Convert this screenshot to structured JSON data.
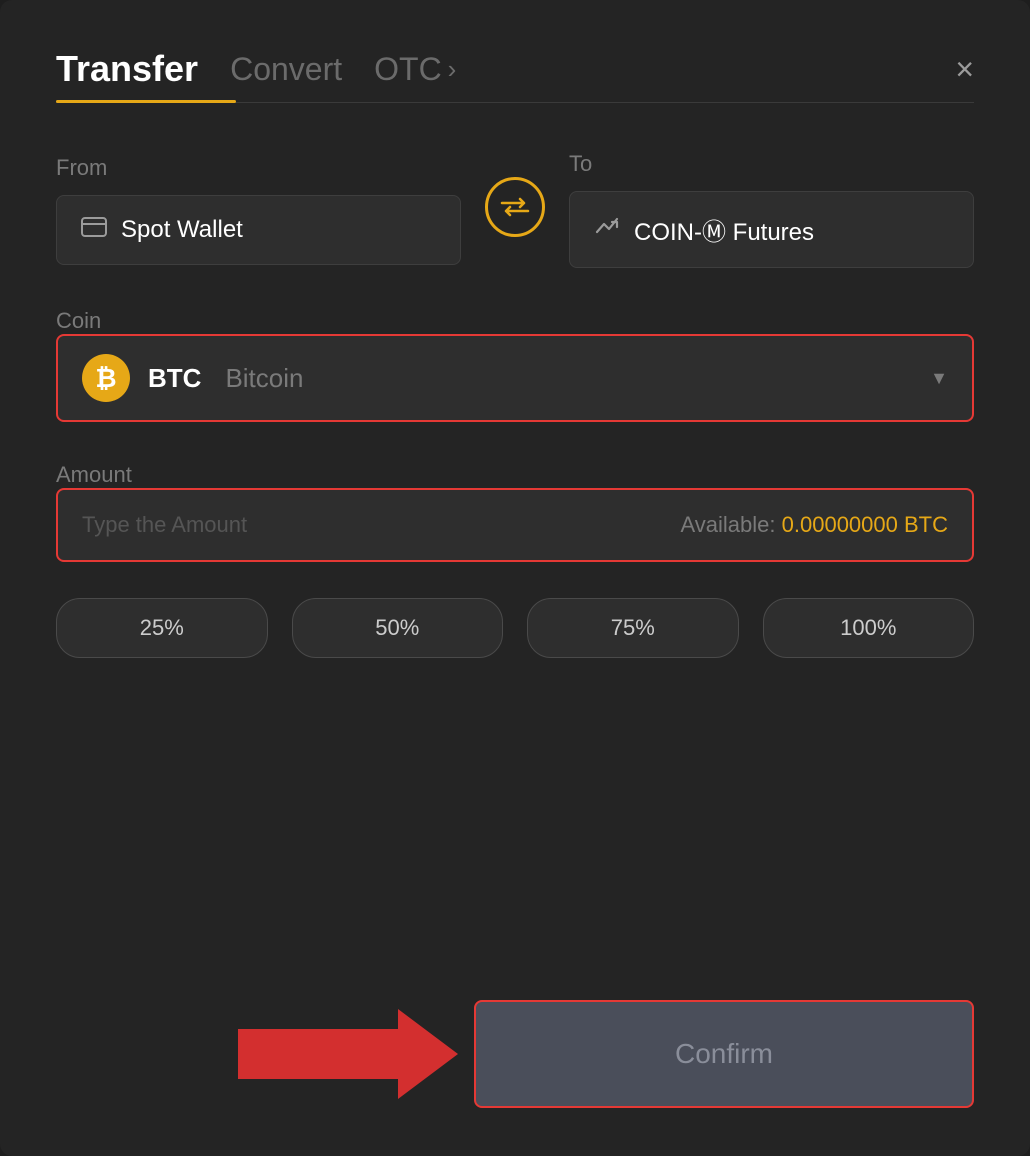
{
  "header": {
    "tab_transfer": "Transfer",
    "tab_convert": "Convert",
    "tab_otc": "OTC",
    "close_label": "×"
  },
  "from": {
    "label": "From",
    "wallet_name": "Spot Wallet"
  },
  "to": {
    "label": "To",
    "wallet_name": "COIN-Ⓜ Futures"
  },
  "coin": {
    "label": "Coin",
    "symbol": "BTC",
    "name": "Bitcoin"
  },
  "amount": {
    "label": "Amount",
    "placeholder": "Type the Amount",
    "available_label": "Available:",
    "available_value": "0.00000000",
    "available_unit": "BTC"
  },
  "percent_buttons": [
    {
      "label": "25%"
    },
    {
      "label": "50%"
    },
    {
      "label": "75%"
    },
    {
      "label": "100%"
    }
  ],
  "confirm_button": {
    "label": "Confirm"
  }
}
